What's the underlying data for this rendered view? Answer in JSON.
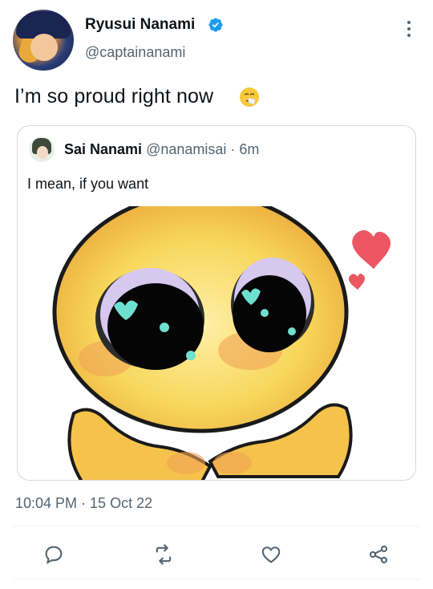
{
  "tweet": {
    "author_name": "Ryusui Nanami",
    "author_handle": "@captainanami",
    "text": "I’m so proud right now",
    "timestamp": "10:04 PM · 15 Oct 22"
  },
  "quote": {
    "author_name": "Sai Nanami",
    "author_handle": "@nanamisai",
    "separator": "·",
    "time": "6m",
    "text": "I mean, if you want"
  },
  "icons": {
    "verified": "verified-badge-icon",
    "more": "more-vertical-icon",
    "emoji": "sneezing-face-emoji",
    "reply": "reply-icon",
    "retweet": "retweet-icon",
    "like": "heart-icon",
    "share": "share-icon"
  },
  "colors": {
    "accent": "#1d9bf0",
    "secondary_text": "#536471",
    "border": "#cfd9de"
  }
}
